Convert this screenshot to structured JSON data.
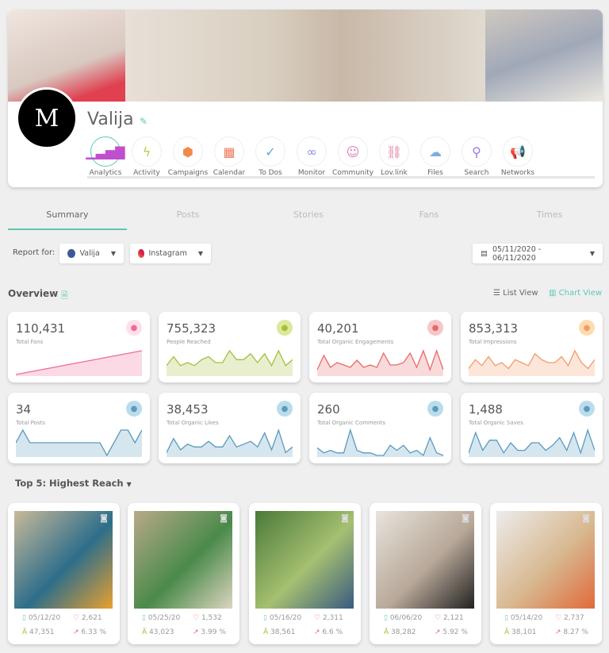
{
  "profile": {
    "initial": "M",
    "name": "Valija"
  },
  "nav": [
    {
      "label": "Analytics",
      "icon": "bar-chart-icon",
      "glyph": "▁▃▅▇",
      "color": "#c04fd0",
      "active": true
    },
    {
      "label": "Activity",
      "icon": "lightning-icon",
      "glyph": "ϟ",
      "color": "#b7d04a"
    },
    {
      "label": "Campaigns",
      "icon": "boxes-icon",
      "glyph": "⬢",
      "color": "#f08a4b"
    },
    {
      "label": "Calendar",
      "icon": "calendar-icon",
      "glyph": "▦",
      "color": "#f07a5a"
    },
    {
      "label": "To Dos",
      "icon": "check-icon",
      "glyph": "✓",
      "color": "#5aa9e0"
    },
    {
      "label": "Monitor",
      "icon": "binoculars-icon",
      "glyph": "∞",
      "color": "#8a8ee0"
    },
    {
      "label": "Community",
      "icon": "chat-smile-icon",
      "glyph": "☺",
      "color": "#e07ab0"
    },
    {
      "label": "Lov.link",
      "icon": "link-icon",
      "glyph": "⛓",
      "color": "#e07a9a"
    },
    {
      "label": "Files",
      "icon": "cloud-icon",
      "glyph": "☁",
      "color": "#7ab0e0"
    },
    {
      "label": "Search",
      "icon": "search-icon",
      "glyph": "⚲",
      "color": "#a07ae0"
    },
    {
      "label": "Networks",
      "icon": "megaphone-icon",
      "glyph": "📢",
      "color": "#f07a5a"
    }
  ],
  "tabs": [
    "Summary",
    "Posts",
    "Stories",
    "Fans",
    "Times"
  ],
  "report": {
    "label": "Report for:",
    "account": "Valija",
    "network": "Instagram",
    "date_range": "05/11/2020 - 06/11/2020"
  },
  "overview": {
    "title": "Overview",
    "list_view": "List View",
    "chart_view": "Chart View"
  },
  "metrics": [
    {
      "value": "110,431",
      "label": "Total Fans",
      "icon": "fans-icon",
      "color": "#f06a9a",
      "bg": "#fde0ea",
      "trend": [
        0,
        1,
        2,
        3,
        4,
        5,
        6,
        7,
        8,
        9,
        10
      ]
    },
    {
      "value": "755,323",
      "label": "People Reached",
      "icon": "reach-icon",
      "color": "#a5bf3a",
      "bg": "#dbe99a",
      "trend": [
        3,
        6,
        3,
        4,
        3,
        5,
        6,
        4,
        4,
        8,
        5,
        5,
        7,
        4,
        7,
        3,
        8,
        3,
        5
      ]
    },
    {
      "value": "40,201",
      "label": "Total Organic Engagements",
      "icon": "engagement-icon",
      "color": "#e86a6a",
      "bg": "#f7c7c7",
      "trend": [
        2,
        8,
        3,
        5,
        4,
        3,
        6,
        3,
        4,
        3,
        9,
        4,
        4,
        5,
        9,
        3,
        10,
        2,
        10,
        2
      ]
    },
    {
      "value": "853,313",
      "label": "Total Impressions",
      "icon": "impressions-icon",
      "color": "#f59a6a",
      "bg": "#fbdcb0",
      "trend": [
        2,
        5,
        3,
        6,
        3,
        4,
        2,
        5,
        4,
        3,
        7,
        5,
        4,
        4,
        6,
        3,
        8,
        4,
        2,
        5
      ]
    },
    {
      "value": "34",
      "label": "Total Posts",
      "icon": "post-icon",
      "color": "#5a9ac0",
      "bg": "#bcdcec",
      "trend": [
        5,
        10,
        5,
        5,
        5,
        5,
        5,
        5,
        5,
        5,
        5,
        5,
        5,
        0,
        5,
        10,
        10,
        5,
        10
      ]
    },
    {
      "value": "38,453",
      "label": "Total Organic Likes",
      "icon": "heart-icon",
      "color": "#5a9ac0",
      "bg": "#bcdcec",
      "trend": [
        1,
        6,
        2,
        4,
        3,
        3,
        5,
        3,
        3,
        7,
        3,
        4,
        5,
        3,
        8,
        2,
        9,
        1,
        3
      ]
    },
    {
      "value": "260",
      "label": "Total Organic Comments",
      "icon": "comment-icon",
      "color": "#5a9ac0",
      "bg": "#bcdcec",
      "trend": [
        3,
        1,
        2,
        1,
        1,
        10,
        2,
        1,
        1,
        0,
        0,
        4,
        2,
        4,
        1,
        2,
        0,
        7,
        1,
        0
      ]
    },
    {
      "value": "1,488",
      "label": "Total Organic Saves",
      "icon": "bookmark-icon",
      "color": "#5a9ac0",
      "bg": "#bcdcec",
      "trend": [
        1,
        9,
        2,
        6,
        6,
        1,
        5,
        2,
        2,
        5,
        5,
        2,
        4,
        7,
        2,
        9,
        1,
        10,
        2
      ]
    }
  ],
  "top": {
    "title": "Top 5: Highest Reach"
  },
  "posts": [
    {
      "date": "05/12/20",
      "likes": "2,621",
      "reach": "47,351",
      "rate": "6.33 %",
      "colors": [
        "#c9b99a",
        "#2d6e8a",
        "#e8a030"
      ]
    },
    {
      "date": "05/25/20",
      "likes": "1,532",
      "reach": "43,023",
      "rate": "3.99 %",
      "colors": [
        "#b9a988",
        "#4a8a4a",
        "#ddd5c0"
      ]
    },
    {
      "date": "05/16/20",
      "likes": "2,311",
      "reach": "38,561",
      "rate": "6.6 %",
      "colors": [
        "#4a7a3a",
        "#a5c070",
        "#3a5a80"
      ]
    },
    {
      "date": "06/06/20",
      "likes": "2,121",
      "reach": "38,282",
      "rate": "5.92 %",
      "colors": [
        "#e8e4de",
        "#b8a898",
        "#222"
      ]
    },
    {
      "date": "05/14/20",
      "likes": "2,737",
      "reach": "38,101",
      "rate": "8.27 %",
      "colors": [
        "#ececec",
        "#d8b890",
        "#e06a3a"
      ]
    }
  ]
}
